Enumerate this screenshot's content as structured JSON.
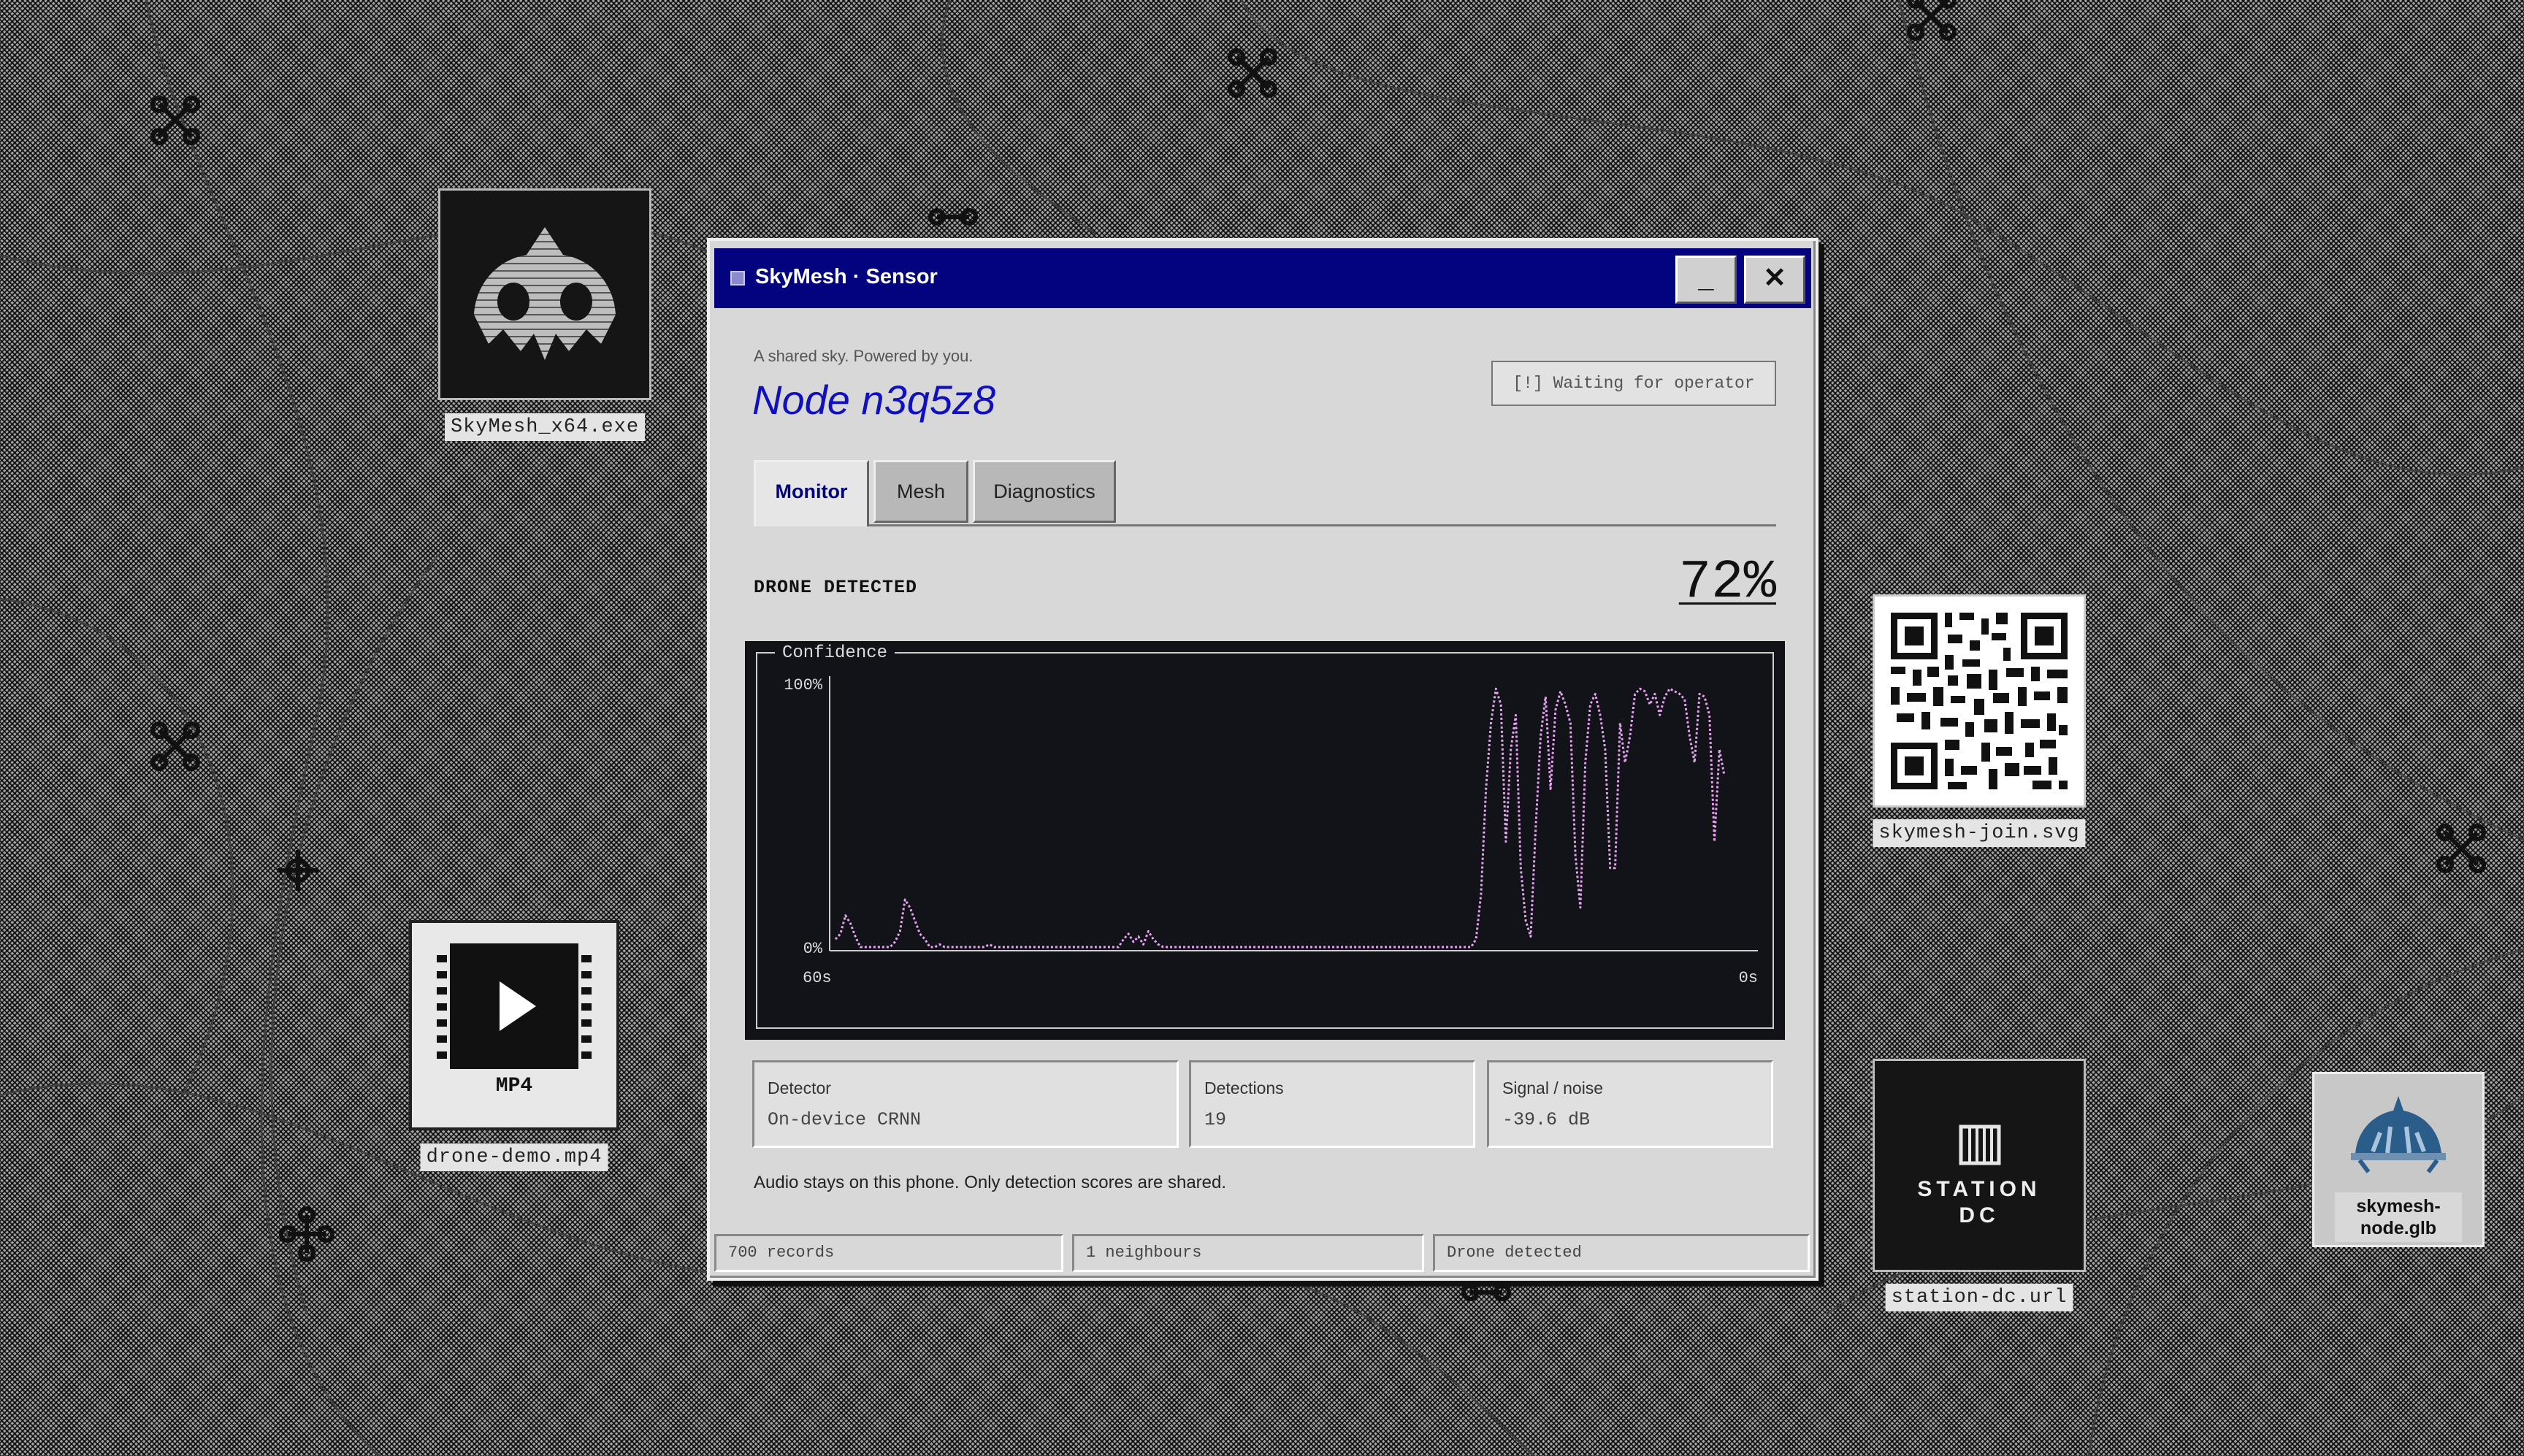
{
  "desktop": {
    "icons": [
      {
        "label": "SkyMesh_x64.exe",
        "icon": "skymesh-app-icon"
      },
      {
        "label": "drone-demo.mp4",
        "icon": "video-chip-icon",
        "badge": "MP4"
      },
      {
        "label": "skymesh-join.svg",
        "icon": "qr-code-icon"
      },
      {
        "label": "station-dc.url",
        "icon": "station-icon",
        "text": "STATION DC"
      },
      {
        "label": "skymesh-node.glb",
        "icon": "dome-model-icon"
      }
    ]
  },
  "window": {
    "title": "SkyMesh · Sensor",
    "minimize_label": "_",
    "close_label": "✕",
    "tagline": "A shared sky. Powered by you.",
    "node_title": "Node n3q5z8",
    "status_pill": "[!] Waiting for operator",
    "tabs": [
      {
        "label": "Monitor",
        "active": true
      },
      {
        "label": "Mesh",
        "active": false
      },
      {
        "label": "Diagnostics",
        "active": false
      }
    ],
    "detection_label": "DRONE DETECTED",
    "detection_value": "72%",
    "stats": [
      {
        "key": "Detector",
        "value": "On-device CRNN"
      },
      {
        "key": "Detections",
        "value": "19"
      },
      {
        "key": "Signal / noise",
        "value": "-39.6 dB"
      }
    ],
    "note": "Audio stays on this phone. Only detection scores are shared.",
    "statusbar": [
      "700 records",
      "1 neighbours",
      "Drone detected"
    ]
  },
  "chart_data": {
    "type": "line",
    "title": "Confidence",
    "y_tick_labels": [
      "100%",
      "0%"
    ],
    "x_tick_labels": [
      "60s",
      "0s"
    ],
    "xlim": [
      60,
      0
    ],
    "ylim": [
      0,
      100
    ],
    "series_color": "#e8a0f0",
    "series": [
      {
        "values": [
          3,
          5,
          12,
          9,
          4,
          0,
          0,
          0,
          0,
          0,
          0,
          0,
          2,
          6,
          18,
          15,
          10,
          5,
          3,
          0,
          0,
          1,
          0,
          0,
          0,
          0,
          0,
          0,
          0,
          0,
          0,
          1,
          0,
          0,
          0,
          0,
          0,
          0,
          0,
          0,
          0,
          0,
          0,
          0,
          0,
          0,
          0,
          0,
          0,
          0,
          0,
          0,
          0,
          0,
          0,
          0,
          0,
          0,
          3,
          5,
          2,
          4,
          1,
          6,
          3,
          1,
          0,
          0,
          0,
          0,
          0,
          0,
          0,
          0,
          0,
          0,
          0,
          0,
          0,
          0,
          0,
          0,
          0,
          0,
          0,
          0,
          0,
          0,
          0,
          0,
          0,
          0,
          0,
          0,
          0,
          0,
          0,
          0,
          0,
          0,
          0,
          0,
          0,
          0,
          0,
          0,
          0,
          0,
          0,
          0,
          0,
          0,
          0,
          0,
          0,
          0,
          0,
          0,
          0,
          0,
          0,
          0,
          0,
          0,
          0,
          0,
          0,
          0,
          0,
          3,
          20,
          60,
          85,
          98,
          92,
          40,
          75,
          88,
          30,
          10,
          4,
          45,
          80,
          95,
          60,
          90,
          97,
          92,
          85,
          35,
          15,
          70,
          92,
          96,
          88,
          75,
          30,
          30,
          85,
          70,
          80,
          96,
          98,
          97,
          92,
          96,
          88,
          95,
          98,
          97,
          96,
          94,
          80,
          70,
          96,
          95,
          88,
          40,
          75,
          65
        ]
      }
    ]
  }
}
